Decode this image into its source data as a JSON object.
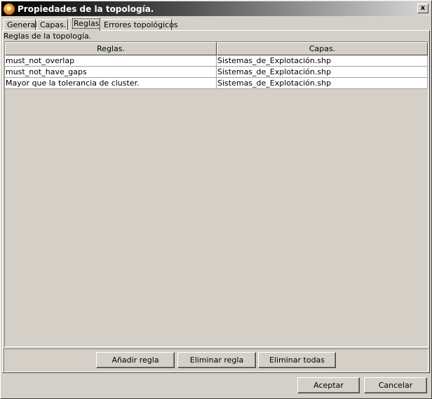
{
  "window": {
    "title": "Propiedades de la topología.",
    "close_glyph": "x"
  },
  "tabs": [
    {
      "label": "General"
    },
    {
      "label": "Capas."
    },
    {
      "label": "Reglas",
      "active": true
    },
    {
      "label": "Errores topológicos"
    }
  ],
  "rules_panel": {
    "section_label": "Reglas de la topología.",
    "columns": [
      "Reglas.",
      "Capas."
    ],
    "rows": [
      [
        "must_not_overlap",
        "Sistemas_de_Explotación.shp"
      ],
      [
        "must_not_have_gaps",
        "Sistemas_de_Explotación.shp"
      ],
      [
        "Mayor que la tolerancia de cluster.",
        "Sistemas_de_Explotación.shp"
      ]
    ],
    "buttons": {
      "add": "Añadir regla",
      "remove": "Eliminar regla",
      "remove_all": "Eliminar todas"
    }
  },
  "dialog_buttons": {
    "ok": "Aceptar",
    "cancel": "Cancelar"
  }
}
